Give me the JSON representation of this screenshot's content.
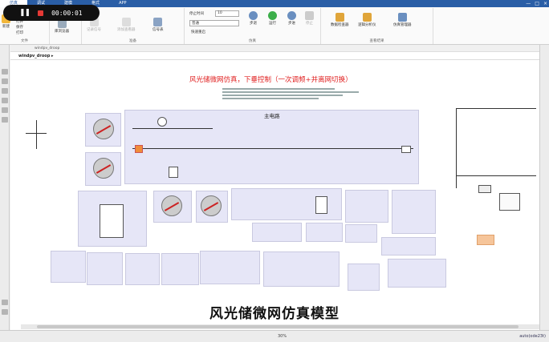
{
  "ribbon": {
    "tabs": [
      "仿真",
      "调试",
      "建模",
      "格式",
      "APP"
    ],
    "active_tab": 0,
    "window_controls": [
      "—",
      "□",
      "×"
    ]
  },
  "recorder": {
    "time": "00:00:01"
  },
  "toolstrip": {
    "file": {
      "new": "新建",
      "open": "打开",
      "save": "保存",
      "print": "打印",
      "group": "文件"
    },
    "library": {
      "label": "库浏览器"
    },
    "prepare": {
      "log_signals": "记录信号",
      "add_viewer": "添加查看器",
      "signal_table": "信号表",
      "group": "准备"
    },
    "simulation": {
      "stop_time_label": "停止时间",
      "stop_time": "10",
      "mode": "普通",
      "fast_restart": "快速重启",
      "step_back": "步退",
      "run": "运行",
      "step_forward": "步进",
      "stop": "停止",
      "group": "仿真"
    },
    "review": {
      "data_inspector": "数据检查器",
      "logic_analyzer": "逻辑分析仪",
      "sim_manager": "仿真管理器",
      "group": "查看结果"
    }
  },
  "editor": {
    "file_tab": "windpv_droop",
    "breadcrumb": "windpv_droop ▸"
  },
  "model": {
    "title": "风光储微网仿真，下垂控制（一次调频+并离网切换）",
    "main_circuit_label": "主电路"
  },
  "caption": "风光储微网仿真模型",
  "status": {
    "zoom": "30%",
    "solver": "auto(ode23t)"
  },
  "colors": {
    "accent": "#2a5ea6",
    "title_red": "#e02020",
    "block_fill": "#e6e6f7",
    "highlight": "#f08c3a"
  }
}
